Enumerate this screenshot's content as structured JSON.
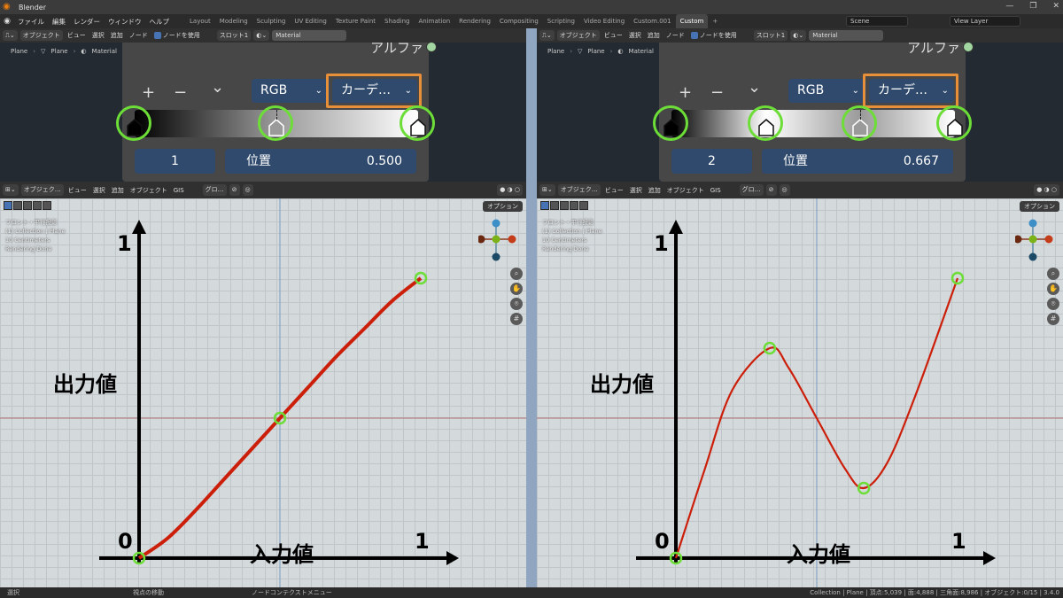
{
  "window": {
    "title": "Blender",
    "minimize": "—",
    "maximize": "❐",
    "close": "✕"
  },
  "topbar": {
    "menus": [
      "ファイル",
      "編集",
      "レンダー",
      "ウィンドウ",
      "ヘルプ"
    ],
    "workspaces": [
      "Layout",
      "Modeling",
      "Sculpting",
      "UV Editing",
      "Texture Paint",
      "Shading",
      "Animation",
      "Rendering",
      "Compositing",
      "Scripting",
      "Video Editing",
      "Custom.001",
      "Custom"
    ],
    "active_workspace": "Custom",
    "add_tab": "+",
    "scene": "Scene",
    "view_layer": "View Layer"
  },
  "node_header": {
    "object_mode": "オブジェクト",
    "menus": [
      "ビュー",
      "選択",
      "追加",
      "ノード"
    ],
    "use_nodes": "ノードを使用",
    "slot": "スロット1",
    "material": "Material"
  },
  "breadcrumb": {
    "items": [
      "Plane",
      "Plane",
      "Material"
    ]
  },
  "viewport_header": {
    "object_mode": "オブジェク…",
    "menus": [
      "ビュー",
      "選択",
      "追加",
      "オブジェクト",
      "GIS"
    ],
    "transform": "グロ…",
    "options": "オプション"
  },
  "viewport_info": {
    "lines": [
      "フロント・平行投影",
      "(1) Collection | Plane",
      "10 Centimeters",
      "Rendering Done"
    ]
  },
  "color_ramp": {
    "alpha_label": "アルファ",
    "add": "+",
    "remove": "−",
    "menu": "⌄",
    "color_mode": "RGB",
    "interpolation": "カーデ…",
    "position_label": "位置"
  },
  "panels": [
    {
      "id": "left",
      "active_index": "1",
      "position": "0.500",
      "stops": [
        0,
        0.5,
        1
      ],
      "stop_colors": [
        "#000000",
        "#9a9a9a",
        "#ffffff"
      ],
      "active_stop": 1
    },
    {
      "id": "right",
      "active_index": "2",
      "position": "0.667",
      "stops": [
        0,
        0.333,
        0.667,
        1
      ],
      "stop_colors": [
        "#000000",
        "#ffffff",
        "#9a9a9a",
        "#ffffff"
      ],
      "active_stop": 2
    }
  ],
  "chart_data": [
    {
      "type": "line",
      "title": "",
      "xlabel": "入力値",
      "ylabel": "出力値",
      "x_ticks": [
        "0",
        "1"
      ],
      "y_ticks": [
        "1"
      ],
      "xlim": [
        0,
        1
      ],
      "ylim": [
        0,
        1
      ],
      "control_points": [
        {
          "x": 0,
          "y": 0
        },
        {
          "x": 0.5,
          "y": 0.5
        },
        {
          "x": 1,
          "y": 1
        }
      ],
      "series": [
        {
          "values": [
            [
              0,
              0
            ],
            [
              0.1,
              0.07
            ],
            [
              0.2,
              0.17
            ],
            [
              0.3,
              0.28
            ],
            [
              0.4,
              0.39
            ],
            [
              0.5,
              0.5
            ],
            [
              0.6,
              0.61
            ],
            [
              0.7,
              0.72
            ],
            [
              0.8,
              0.82
            ],
            [
              0.9,
              0.92
            ],
            [
              1,
              1
            ]
          ]
        }
      ]
    },
    {
      "type": "line",
      "title": "",
      "xlabel": "入力値",
      "ylabel": "出力値",
      "x_ticks": [
        "0",
        "1"
      ],
      "y_ticks": [
        "1"
      ],
      "xlim": [
        0,
        1
      ],
      "ylim": [
        0,
        1
      ],
      "control_points": [
        {
          "x": 0,
          "y": 0
        },
        {
          "x": 0.333,
          "y": 0.75
        },
        {
          "x": 0.667,
          "y": 0.25
        },
        {
          "x": 1,
          "y": 1
        }
      ],
      "series": [
        {
          "values": [
            [
              0,
              0
            ],
            [
              0.1,
              0.31
            ],
            [
              0.2,
              0.6
            ],
            [
              0.333,
              0.75
            ],
            [
              0.4,
              0.68
            ],
            [
              0.5,
              0.5
            ],
            [
              0.6,
              0.32
            ],
            [
              0.667,
              0.25
            ],
            [
              0.75,
              0.34
            ],
            [
              0.85,
              0.58
            ],
            [
              1,
              1
            ]
          ]
        }
      ]
    }
  ],
  "statusbar": {
    "select": "選択",
    "pan": "視点の移動",
    "context": "ノードコンテクストメニュー",
    "stats": "Collection | Plane | 頂点:5,039 | 面:4,888 | 三角面:8,986 | オブジェクト:0/15 | 3.4.0"
  },
  "colors": {
    "accent": "#4772b3",
    "field": "#2f4a6d",
    "curve": "#cc1f0a",
    "highlight": "#6dde38",
    "frame": "#e88f3a"
  }
}
